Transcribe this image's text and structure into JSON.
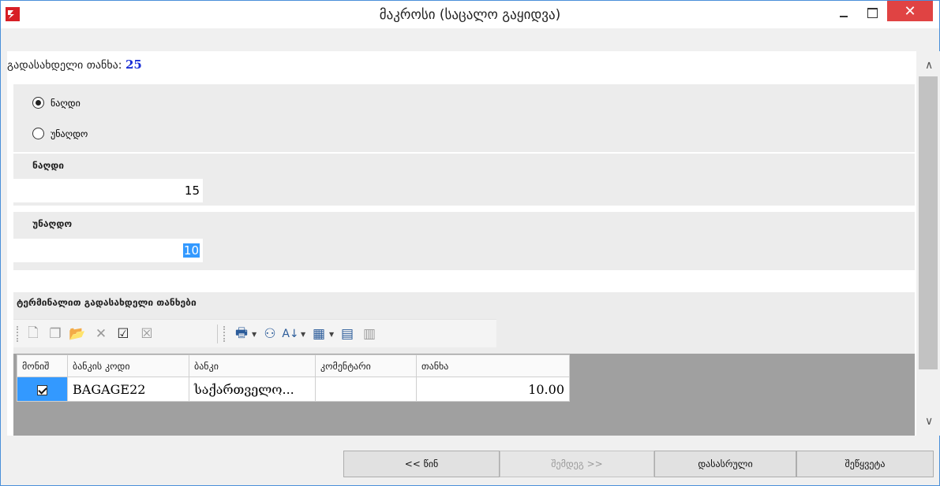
{
  "window": {
    "title": "მაკროსი (საცალო გაყიდვა)",
    "close_glyph": "✕",
    "close_color": "#e04343",
    "app_icon": "app-logo-icon"
  },
  "payment": {
    "amount_label": "გადასახდელი თანხა:",
    "amount_value": "25"
  },
  "radios": [
    {
      "label": "ნაღდი",
      "checked": true
    },
    {
      "label": "უნაღდო",
      "checked": false
    }
  ],
  "fields": {
    "cash_label": "ნაღდი",
    "cash_value": "15",
    "noncash_label": "უნაღდო",
    "noncash_value": "10"
  },
  "terminal": {
    "title": "ტერმინალით გადასახდელი თანხები",
    "toolbar_icons": [
      "new-document-icon",
      "copy-icon",
      "open-folder-icon",
      "delete-icon",
      "check-icon",
      "uncheck-icon",
      "print-icon",
      "find-icon",
      "sort-icon",
      "format-icon",
      "export-icon",
      "columns-icon"
    ],
    "columns": [
      "მონიშ",
      "ბანკის კოდი",
      "ბანკი",
      "კომენტარი",
      "თანხა"
    ],
    "rows": [
      {
        "checked": true,
        "bank_code": "BAGAGE22",
        "bank": "საქართველო...",
        "comment": "",
        "amount": "10.00"
      }
    ]
  },
  "buttons": {
    "back": "<< წინ",
    "next": "შემდეგ >>",
    "finish": "დასასრული",
    "cancel": "შეწყვეტა"
  },
  "colors": {
    "accent": "#1a2fd6",
    "selection": "#3399ff"
  }
}
